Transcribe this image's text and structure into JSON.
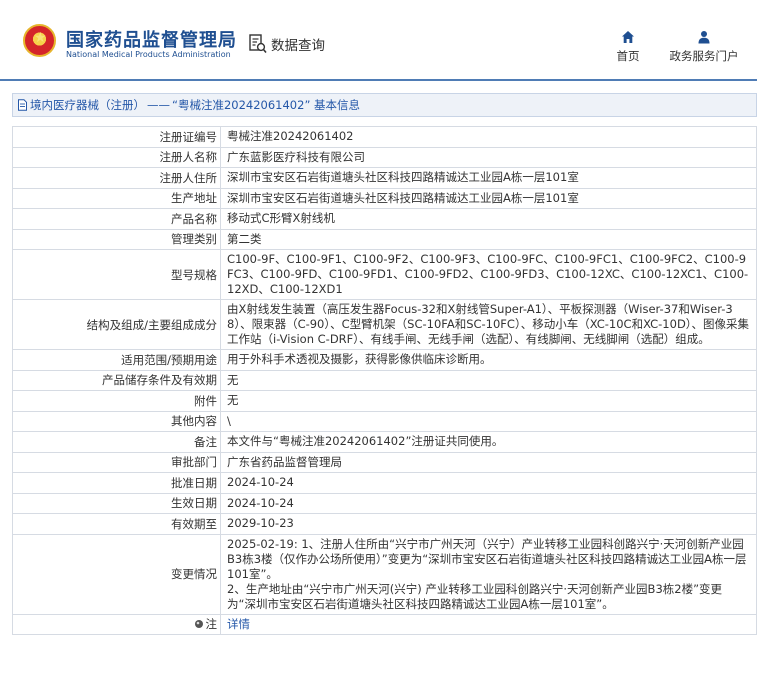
{
  "header": {
    "org_name_cn": "国家药品监督管理局",
    "org_name_en": "National Medical Products Administration",
    "query_label": "数据查询",
    "nav": [
      {
        "label": "首页",
        "icon": "home-icon"
      },
      {
        "label": "政务服务门户",
        "icon": "person-icon"
      }
    ],
    "brand_color": "#1f4f91"
  },
  "breadcrumb": {
    "category": "境内医疗器械（注册）",
    "separator": "——",
    "current": "“粤械注准20242061402” 基本信息"
  },
  "record": {
    "rows": [
      {
        "label": "注册证编号",
        "value": "粤械注准20242061402"
      },
      {
        "label": "注册人名称",
        "value": "广东蓝影医疗科技有限公司"
      },
      {
        "label": "注册人住所",
        "value": "深圳市宝安区石岩街道塘头社区科技四路精诚达工业园A栋一层101室"
      },
      {
        "label": "生产地址",
        "value": "深圳市宝安区石岩街道塘头社区科技四路精诚达工业园A栋一层101室"
      },
      {
        "label": "产品名称",
        "value": "移动式C形臂X射线机"
      },
      {
        "label": "管理类别",
        "value": "第二类"
      },
      {
        "label": "型号规格",
        "value": "C100-9F、C100-9F1、C100-9F2、C100-9F3、C100-9FC、C100-9FC1、C100-9FC2、C100-9FC3、C100-9FD、C100-9FD1、C100-9FD2、C100-9FD3、C100-12XC、C100-12XC1、C100-12XD、C100-12XD1"
      },
      {
        "label": "结构及组成/主要组成成分",
        "value": "由X射线发生装置（高压发生器Focus-32和X射线管Super-A1）、平板探测器（Wiser-37和Wiser-38）、限束器（C-90）、C型臂机架（SC-10FA和SC-10FC）、移动小车（XC-10C和XC-10D）、图像采集工作站（i-Vision C-DRF）、有线手闸、无线手闸（选配）、有线脚闸、无线脚闸（选配）组成。"
      },
      {
        "label": "适用范围/预期用途",
        "value": "用于外科手术透视及摄影，获得影像供临床诊断用。"
      },
      {
        "label": "产品储存条件及有效期",
        "value": "无"
      },
      {
        "label": "附件",
        "value": "无"
      },
      {
        "label": "其他内容",
        "value": "\\"
      },
      {
        "label": "备注",
        "value": "本文件与“粤械注准20242061402”注册证共同使用。"
      },
      {
        "label": "审批部门",
        "value": "广东省药品监督管理局"
      },
      {
        "label": "批准日期",
        "value": "2024-10-24"
      },
      {
        "label": "生效日期",
        "value": "2024-10-24"
      },
      {
        "label": "有效期至",
        "value": "2029-10-23"
      },
      {
        "label": "变更情况",
        "value": "2025-02-19: 1、注册人住所由“兴宁市广州天河（兴宁）产业转移工业园科创路兴宁·天河创新产业园B3栋3楼（仅作办公场所使用）”变更为“深圳市宝安区石岩街道塘头社区科技四路精诚达工业园A栋一层101室”。\n2、生产地址由“兴宁市广州天河(兴宁) 产业转移工业园科创路兴宁·天河创新产业园B3栋2楼”变更为“深圳市宝安区石岩街道塘头社区科技四路精诚达工业园A栋一层101室”。"
      }
    ],
    "note_label": "注",
    "note_link": "详情"
  }
}
